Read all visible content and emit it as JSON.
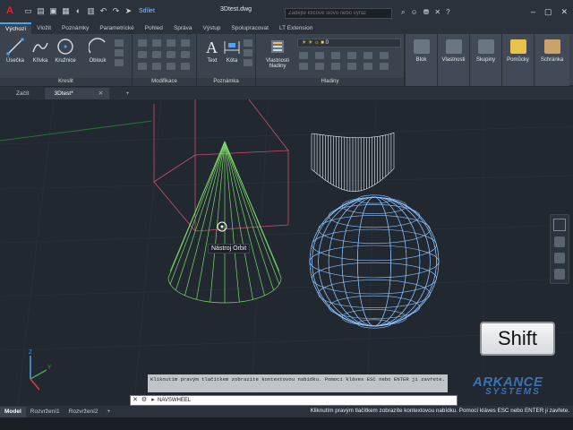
{
  "titlebar": {
    "logo": "A",
    "share": "Sdílet",
    "document_title": "3Dtest.dwg",
    "search_placeholder": "Zadejte klíčové slovo nebo výraz"
  },
  "ribbon_tabs": [
    "Výchozí",
    "Vložit",
    "Poznámky",
    "Parametrické",
    "Pohled",
    "Správa",
    "Výstup",
    "Spolupracovat",
    "LT Extension"
  ],
  "ribbon": {
    "draw": {
      "label": "Kreslit",
      "tools": [
        "Úsečka",
        "Křivka",
        "Kružnice",
        "Oblouk"
      ]
    },
    "modify": {
      "label": "Modifikace"
    },
    "annotation": {
      "label": "Poznámka",
      "tools": [
        "Text",
        "Kóta"
      ]
    },
    "layers": {
      "label": "Hladiny",
      "tool": "Vlastnosti hladiny",
      "current_layer": "0"
    },
    "panels": [
      "Blok",
      "Vlastnosti",
      "Skupiny",
      "Pomůcky",
      "Schránka"
    ]
  },
  "file_tabs": [
    "Začít",
    "3Dtest*"
  ],
  "viewport": {
    "tooltip": "Nástroj Orbit",
    "shift_key": "Shift",
    "watermark_top": "ARKANCE",
    "watermark_bottom": "SYSTEMS",
    "colors": {
      "box": "#c8506a",
      "cone": "#7ed96b",
      "sphere": "#8fc4ff",
      "curve": "#e8ecef"
    }
  },
  "command": {
    "history": "Kliknutím pravým tlačítkem zobrazíte kontextovou nabídku. Pomocí kláves ESC nebo ENTER ji zavřete.",
    "current": "NAVSWHEEL"
  },
  "layout_tabs": [
    "Model",
    "Rozvržení1",
    "Rozvržení2"
  ],
  "status_message": "Kliknutím pravým tlačítkem zobrazíte kontextovou nabídku. Pomocí kláves ESC nebo ENTER ji zavřete."
}
